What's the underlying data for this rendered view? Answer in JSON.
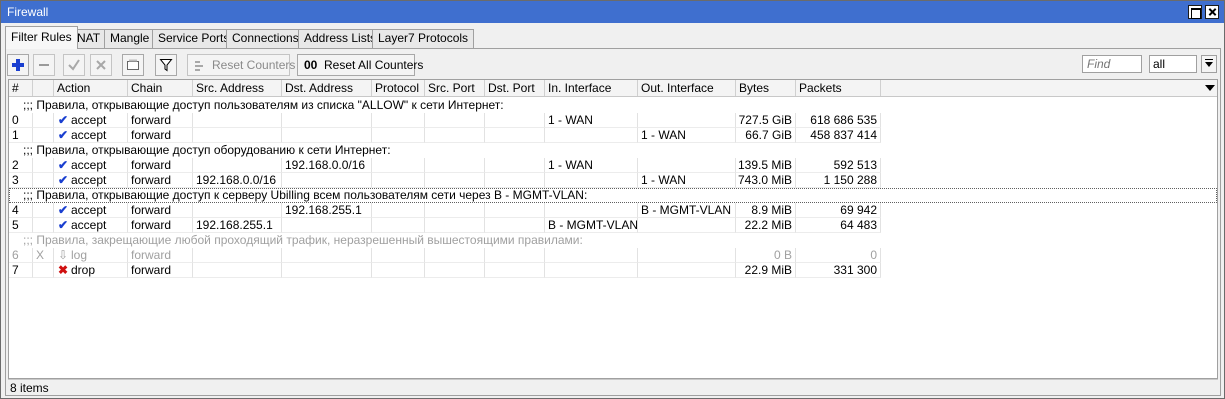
{
  "window": {
    "title": "Firewall"
  },
  "tabs": [
    {
      "label": "Filter Rules",
      "active": true
    },
    {
      "label": "NAT"
    },
    {
      "label": "Mangle"
    },
    {
      "label": "Service Ports"
    },
    {
      "label": "Connections"
    },
    {
      "label": "Address Lists"
    },
    {
      "label": "Layer7 Protocols"
    }
  ],
  "toolbar": {
    "add_icon": "plus-icon",
    "remove_icon": "minus-icon",
    "enable_icon": "check-icon",
    "disable_icon": "x-icon",
    "comment_icon": "comment-icon",
    "filter_icon": "filter-icon",
    "reset_counters": "Reset Counters",
    "reset_all_counters": "Reset All Counters",
    "reset_all_prefix": "00",
    "find_placeholder": "Find",
    "select_value": "all"
  },
  "table": {
    "columns": [
      "#",
      "",
      "Action",
      "Chain",
      "Src. Address",
      "Dst. Address",
      "Protocol",
      "Src. Port",
      "Dst. Port",
      "In. Interface",
      "Out. Interface",
      "Bytes",
      "Packets"
    ],
    "rows": [
      {
        "comment": ";;; Правила, открывающие доступ пользователям из списка \"ALLOW\" к сети Интернет:"
      },
      {
        "num": "0",
        "flag": "",
        "action": "accept",
        "chain": "forward",
        "src": "",
        "dst": "",
        "proto": "",
        "sport": "",
        "dport": "",
        "in": "1 - WAN",
        "out": "",
        "bytes": "727.5 GiB",
        "packets": "618 686 535"
      },
      {
        "num": "1",
        "flag": "",
        "action": "accept",
        "chain": "forward",
        "src": "",
        "dst": "",
        "proto": "",
        "sport": "",
        "dport": "",
        "in": "",
        "out": "1 - WAN",
        "bytes": "66.7 GiB",
        "packets": "458 837 414"
      },
      {
        "comment": ";;; Правила, открывающие доступ оборудованию к сети Интернет:"
      },
      {
        "num": "2",
        "flag": "",
        "action": "accept",
        "chain": "forward",
        "src": "",
        "dst": "192.168.0.0/16",
        "proto": "",
        "sport": "",
        "dport": "",
        "in": "1 - WAN",
        "out": "",
        "bytes": "139.5 MiB",
        "packets": "592 513"
      },
      {
        "num": "3",
        "flag": "",
        "action": "accept",
        "chain": "forward",
        "src": "192.168.0.0/16",
        "dst": "",
        "proto": "",
        "sport": "",
        "dport": "",
        "in": "",
        "out": "1 - WAN",
        "bytes": "743.0 MiB",
        "packets": "1 150 288"
      },
      {
        "comment": ";;; Правила, открывающие доступ к серверу Ubilling всем пользователям сети через B - MGMT-VLAN:",
        "selected": true
      },
      {
        "num": "4",
        "flag": "",
        "action": "accept",
        "chain": "forward",
        "src": "",
        "dst": "192.168.255.1",
        "proto": "",
        "sport": "",
        "dport": "",
        "in": "",
        "out": "B - MGMT-VLAN",
        "bytes": "8.9 MiB",
        "packets": "69 942"
      },
      {
        "num": "5",
        "flag": "",
        "action": "accept",
        "chain": "forward",
        "src": "192.168.255.1",
        "dst": "",
        "proto": "",
        "sport": "",
        "dport": "",
        "in": "B - MGMT-VLAN",
        "out": "",
        "bytes": "22.2 MiB",
        "packets": "64 483"
      },
      {
        "comment": ";;; Правила, закрещающие любой проходящий трафик, неразрешенный вышестоящими правилами:",
        "disabled": true
      },
      {
        "num": "6",
        "flag": "X",
        "action": "log",
        "chain": "forward",
        "src": "",
        "dst": "",
        "proto": "",
        "sport": "",
        "dport": "",
        "in": "",
        "out": "",
        "bytes": "0 B",
        "packets": "0",
        "disabled": true
      },
      {
        "num": "7",
        "flag": "",
        "action": "drop",
        "chain": "forward",
        "src": "",
        "dst": "",
        "proto": "",
        "sport": "",
        "dport": "",
        "in": "",
        "out": "",
        "bytes": "22.9 MiB",
        "packets": "331 300"
      }
    ]
  },
  "status": {
    "text": "8 items"
  },
  "colors": {
    "titlebar": "#3f6fcf",
    "accept": "#1a3fd0",
    "drop": "#d01010",
    "disabled": "#a0a0a0"
  }
}
